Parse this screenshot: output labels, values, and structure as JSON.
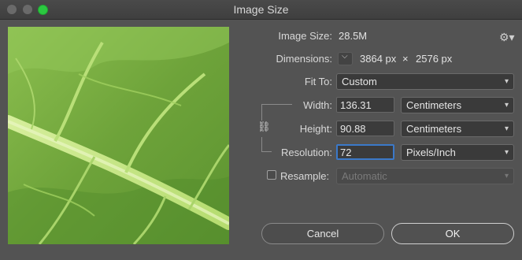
{
  "window": {
    "title": "Image Size"
  },
  "image_size": {
    "label": "Image Size:",
    "value": "28.5M"
  },
  "dimensions": {
    "label": "Dimensions:",
    "width": "3864 px",
    "times": "×",
    "height": "2576 px"
  },
  "fit_to": {
    "label": "Fit To:",
    "value": "Custom"
  },
  "width": {
    "label": "Width:",
    "value": "136.31",
    "unit": "Centimeters"
  },
  "height": {
    "label": "Height:",
    "value": "90.88",
    "unit": "Centimeters"
  },
  "resolution": {
    "label": "Resolution:",
    "value": "72",
    "unit": "Pixels/Inch"
  },
  "resample": {
    "label": "Resample:",
    "checked": false,
    "method": "Automatic"
  },
  "buttons": {
    "cancel": "Cancel",
    "ok": "OK"
  },
  "icons": {
    "settings": "gear-icon",
    "link": "chain-link-icon",
    "dropdown": "chevron-down-icon"
  },
  "colors": {
    "accent": "#3b79c9",
    "maximize": "#2bc840",
    "background": "#535353"
  }
}
